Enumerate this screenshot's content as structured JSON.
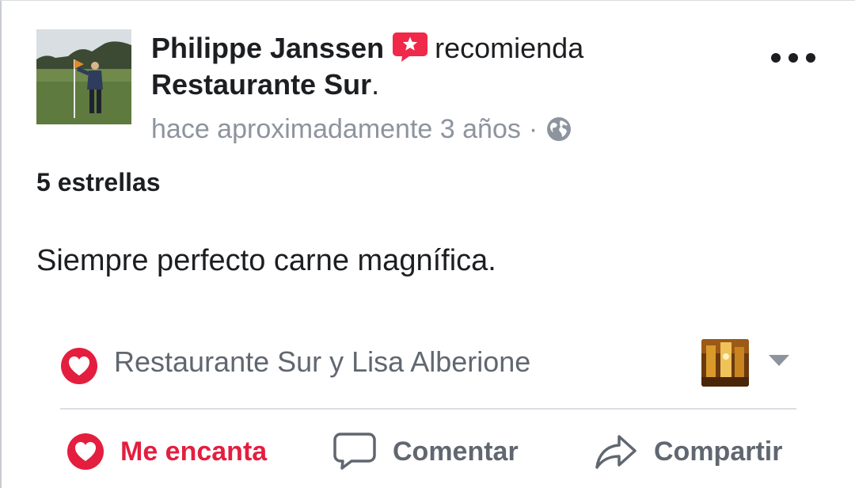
{
  "post": {
    "author": "Philippe Janssen",
    "recommend_verb": "recomienda",
    "page_name": "Restaurante Sur",
    "page_suffix": ".",
    "timestamp": "hace aproximadamente 3 años",
    "separator": "·",
    "privacy_icon": "globe-icon",
    "rating": "5 estrellas",
    "text": "Siempre perfecto carne magnífica."
  },
  "reactions": {
    "icon": "love-icon",
    "names": "Restaurante Sur y Lisa Alberione"
  },
  "actions": {
    "love_label": "Me encanta",
    "comment_label": "Comentar",
    "share_label": "Compartir"
  },
  "colors": {
    "love": "#e41e3f",
    "text": "#1c1e21",
    "muted": "#8d949e",
    "action": "#606770",
    "recommend_badge": "#f02849"
  }
}
